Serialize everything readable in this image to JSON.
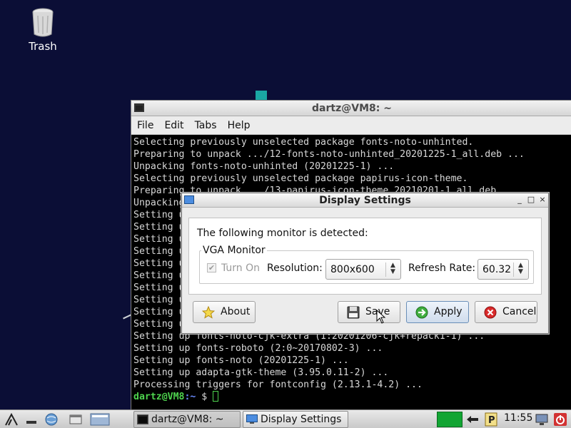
{
  "desktop": {
    "icons": [
      {
        "label": "Trash",
        "icon": "trash-icon"
      }
    ]
  },
  "terminal": {
    "title": "dartz@VM8: ~",
    "menu": [
      "File",
      "Edit",
      "Tabs",
      "Help"
    ],
    "lines": [
      "Selecting previously unselected package fonts-noto-unhinted.",
      "Preparing to unpack .../12-fonts-noto-unhinted_20201225-1_all.deb ...",
      "Unpacking fonts-noto-unhinted (20201225-1) ...",
      "Selecting previously unselected package papirus-icon-theme.",
      "Preparing to unpack .../13-papirus-icon-theme_20210201-1_all.deb ...",
      "Unpacking",
      "Setting u",
      "Setting u",
      "Setting u",
      "Setting u",
      "Setting u",
      "Setting u",
      "Setting u",
      "Setting u",
      "Setting u",
      "Setting u",
      "Setting up fonts-noto-cjk-extra (1:20201206-cjk+repack1-1) ...",
      "Setting up fonts-roboto (2:0~20170802-3) ...",
      "Setting up fonts-noto (20201225-1) ...",
      "Setting up adapta-gtk-theme (3.95.0.11-2) ...",
      "Processing triggers for fontconfig (2.13.1-4.2) ..."
    ],
    "prompt": {
      "user": "dartz@VM8",
      "path": ":~",
      "symbol": " $ "
    }
  },
  "dialog": {
    "title": "Display Settings",
    "detected_text": "The following monitor is detected:",
    "monitor_name": "VGA Monitor",
    "turn_on_label": "Turn On",
    "turn_on_checked": true,
    "turn_on_enabled": false,
    "resolution_label": "Resolution:",
    "resolution_value": "800x600",
    "refresh_label": "Refresh Rate:",
    "refresh_value": "60.32",
    "buttons": {
      "about": "About",
      "save": "Save",
      "apply": "Apply",
      "cancel": "Cancel"
    },
    "window_controls": [
      "_",
      "□",
      "×"
    ]
  },
  "taskbar": {
    "tasks": [
      {
        "label": "dartz@VM8: ~",
        "icon": "terminal-icon"
      },
      {
        "label": "Display Settings",
        "icon": "display-icon"
      }
    ],
    "clock": "11:55",
    "colors": {
      "indicator": "#12a533",
      "terminal_green": "#4ed34e"
    }
  }
}
